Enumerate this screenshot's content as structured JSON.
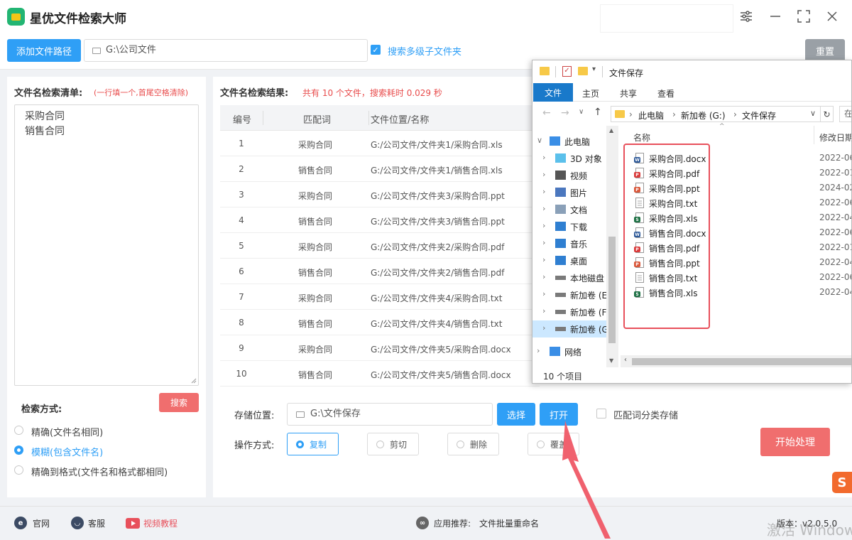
{
  "app": {
    "title": "星优文件检索大师"
  },
  "toolbar": {
    "add_path_label": "添加文件路径",
    "path_value": "G:\\公司文件",
    "search_subfolders_label": "搜索多级子文件夹",
    "reset_label": "重置"
  },
  "keywords": {
    "title": "文件名检索清单:",
    "hint": "(一行填一个,首尾空格清除)",
    "items": [
      "采购合同",
      "销售合同"
    ],
    "search_label": "搜索"
  },
  "search_mode": {
    "title": "检索方式:",
    "options": [
      {
        "label": "精确(文件名相同)",
        "selected": false
      },
      {
        "label": "模糊(包含文件名)",
        "selected": true
      },
      {
        "label": "精确到格式(文件名和格式都相同)",
        "selected": false
      }
    ]
  },
  "results": {
    "title": "文件名检索结果:",
    "summary": "共有 10 个文件，搜索耗时 0.029 秒",
    "headers": [
      "编号",
      "匹配词",
      "文件位置/名称"
    ],
    "rows": [
      [
        "1",
        "采购合同",
        "G:/公司文件/文件夹1/采购合同.xls"
      ],
      [
        "2",
        "销售合同",
        "G:/公司文件/文件夹1/销售合同.xls"
      ],
      [
        "3",
        "采购合同",
        "G:/公司文件/文件夹3/采购合同.ppt"
      ],
      [
        "4",
        "销售合同",
        "G:/公司文件/文件夹3/销售合同.ppt"
      ],
      [
        "5",
        "采购合同",
        "G:/公司文件/文件夹2/采购合同.pdf"
      ],
      [
        "6",
        "销售合同",
        "G:/公司文件/文件夹2/销售合同.pdf"
      ],
      [
        "7",
        "采购合同",
        "G:/公司文件/文件夹4/采购合同.txt"
      ],
      [
        "8",
        "销售合同",
        "G:/公司文件/文件夹4/销售合同.txt"
      ],
      [
        "9",
        "采购合同",
        "G:/公司文件/文件夹5/采购合同.docx"
      ],
      [
        "10",
        "销售合同",
        "G:/公司文件/文件夹5/销售合同.docx"
      ]
    ]
  },
  "storage": {
    "label": "存储位置:",
    "path": "G:\\文件保存",
    "choose_label": "选择",
    "open_label": "打开",
    "classify_label": "匹配词分类存储",
    "operation_label": "操作方式:",
    "operations": [
      {
        "label": "复制",
        "selected": true
      },
      {
        "label": "剪切",
        "selected": false
      },
      {
        "label": "删除",
        "selected": false
      },
      {
        "label": "覆盖",
        "selected": false
      }
    ],
    "start_label": "开始处理"
  },
  "footer": {
    "website": "官网",
    "service": "客服",
    "video": "视频教程",
    "recommend_label": "应用推荐:",
    "recommend_app": "文件批量重命名",
    "version": "版本：v2.0.5.0",
    "watermark": "激活 Windows"
  },
  "explorer": {
    "title": "文件保存",
    "ribbon_tabs": [
      "文件",
      "主页",
      "共享",
      "查看"
    ],
    "address": [
      "此电脑",
      "新加卷 (G:)",
      "文件保存"
    ],
    "search_stub": "在",
    "col_name": "名称",
    "col_date": "修改日期",
    "nav": [
      {
        "label": "此电脑",
        "icon": "pc-icon",
        "expanded": true
      },
      {
        "label": "3D 对象",
        "icon": "cube-icon"
      },
      {
        "label": "视频",
        "icon": "video-icon"
      },
      {
        "label": "图片",
        "icon": "picture-icon"
      },
      {
        "label": "文档",
        "icon": "document-icon"
      },
      {
        "label": "下载",
        "icon": "download-icon"
      },
      {
        "label": "音乐",
        "icon": "music-icon"
      },
      {
        "label": "桌面",
        "icon": "desktop-icon"
      },
      {
        "label": "本地磁盘",
        "icon": "drive-icon"
      },
      {
        "label": "新加卷 (E",
        "icon": "drive-icon"
      },
      {
        "label": "新加卷 (F",
        "icon": "drive-icon"
      },
      {
        "label": "新加卷 (G",
        "icon": "drive-icon",
        "selected": true
      },
      {
        "label": "网络",
        "icon": "network-icon"
      }
    ],
    "files": [
      {
        "name": "采购合同.docx",
        "date": "2022-06",
        "type": "docx"
      },
      {
        "name": "采购合同.pdf",
        "date": "2022-01",
        "type": "pdf"
      },
      {
        "name": "采购合同.ppt",
        "date": "2024-02",
        "type": "ppt"
      },
      {
        "name": "采购合同.txt",
        "date": "2022-06",
        "type": "txt"
      },
      {
        "name": "采购合同.xls",
        "date": "2022-04",
        "type": "xls"
      },
      {
        "name": "销售合同.docx",
        "date": "2022-06",
        "type": "docx"
      },
      {
        "name": "销售合同.pdf",
        "date": "2022-01",
        "type": "pdf"
      },
      {
        "name": "销售合同.ppt",
        "date": "2022-04",
        "type": "ppt"
      },
      {
        "name": "销售合同.txt",
        "date": "2022-06",
        "type": "txt"
      },
      {
        "name": "销售合同.xls",
        "date": "2022-04",
        "type": "xls"
      }
    ],
    "status": "10 个项目"
  },
  "colors": {
    "accent": "#2f9ff6",
    "danger": "#f06e6e",
    "highlight_box": "#e8505b",
    "explorer_file_tab": "#1979ca"
  }
}
